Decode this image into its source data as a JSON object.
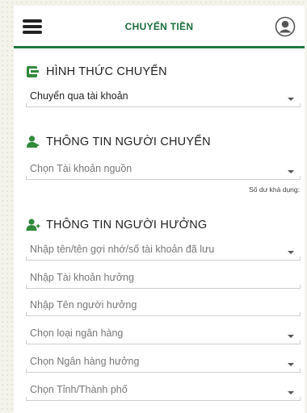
{
  "header": {
    "title": "CHUYỂN TIỀN",
    "menu_icon": "hamburger-menu-icon",
    "profile_icon": "user-avatar-icon"
  },
  "colors": {
    "accent": "#1a6d3d",
    "header_rule": "#1f7a45",
    "icon_green": "#2f8a3a"
  },
  "transfer_method": {
    "heading": "HÌNH THỨC CHUYỂN",
    "icon": "transfer-card-icon",
    "selected": "Chuyển qua tài khoản"
  },
  "sender": {
    "heading": "THÔNG TIN NGƯỜI CHUYỂN",
    "icon": "user-icon",
    "source_account_placeholder": "Chọn Tài khoản nguồn",
    "balance_label": "Số dư khả dụng:"
  },
  "recipient": {
    "heading": "THÔNG TIN NGƯỜI HƯỞNG",
    "icon": "add-user-icon",
    "saved_lookup_placeholder": "Nhập tên/tên gợi nhớ/số tài khoản đã lưu",
    "account_placeholder": "Nhập Tài khoản hưởng",
    "name_placeholder": "Nhập Tên người hưởng",
    "bank_type_placeholder": "Chọn loại ngân hàng",
    "bank_placeholder": "Chọn Ngân hàng hưởng",
    "province_placeholder": "Chọn Tỉnh/Thành phố"
  }
}
